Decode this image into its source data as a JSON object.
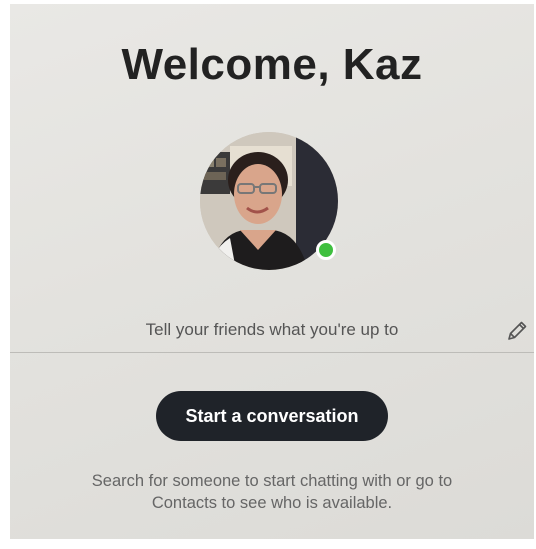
{
  "header": {
    "title": "Welcome, Kaz"
  },
  "profile": {
    "avatar_icon": "user-photo",
    "presence_color": "#3fbf3f",
    "presence_icon": "online-status-dot"
  },
  "mood": {
    "placeholder": "Tell your friends what you're up to",
    "edit_icon": "pencil-icon"
  },
  "actions": {
    "start_conversation_label": "Start a conversation"
  },
  "helper": {
    "line1": "Search for someone to start chatting with or go to",
    "line2": "Contacts to see who is available."
  }
}
